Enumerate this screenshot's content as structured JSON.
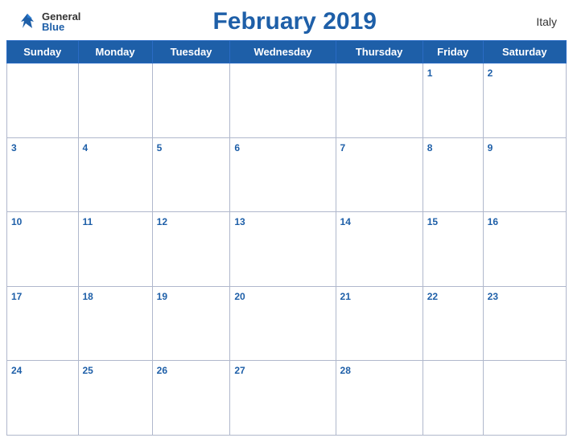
{
  "header": {
    "logo_general": "General",
    "logo_blue": "Blue",
    "title": "February 2019",
    "country": "Italy"
  },
  "days": [
    "Sunday",
    "Monday",
    "Tuesday",
    "Wednesday",
    "Thursday",
    "Friday",
    "Saturday"
  ],
  "weeks": [
    [
      null,
      null,
      null,
      null,
      null,
      1,
      2
    ],
    [
      3,
      4,
      5,
      6,
      7,
      8,
      9
    ],
    [
      10,
      11,
      12,
      13,
      14,
      15,
      16
    ],
    [
      17,
      18,
      19,
      20,
      21,
      22,
      23
    ],
    [
      24,
      25,
      26,
      27,
      28,
      null,
      null
    ]
  ],
  "colors": {
    "header_bg": "#1e5fa8",
    "header_text": "#ffffff",
    "date_number": "#1e5fa8",
    "cell_border": "#b0b8cc"
  }
}
